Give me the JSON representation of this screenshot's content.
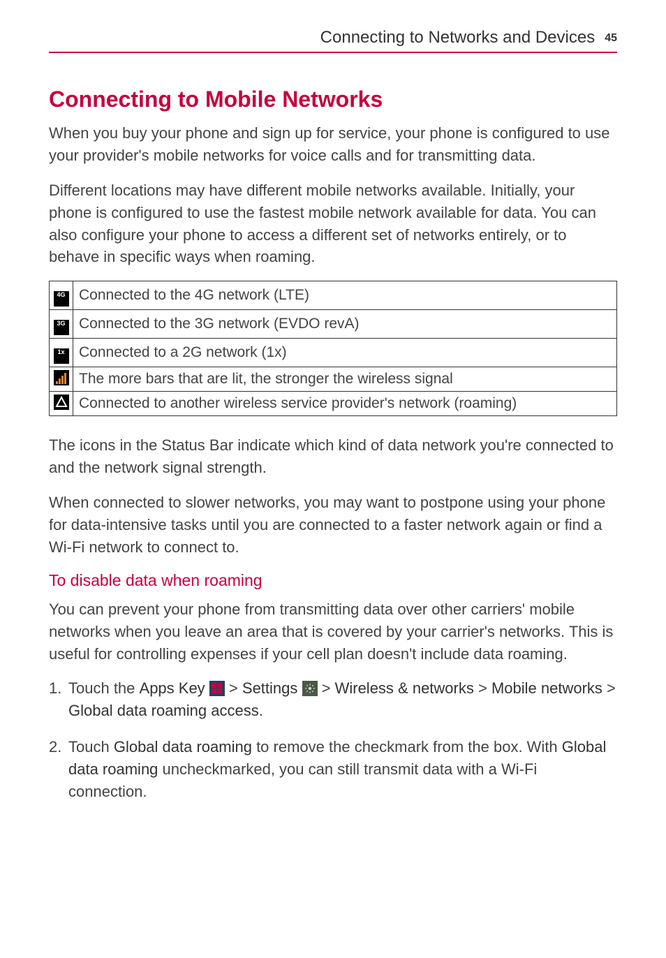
{
  "header": {
    "title": "Connecting to Networks and Devices",
    "page": "45"
  },
  "h1": "Connecting to Mobile Networks",
  "intro1": "When you buy your phone and sign up for service, your phone is configured to use your provider's mobile networks for voice calls and for transmitting data.",
  "intro2": "Different locations may have different mobile networks available. Initially, your phone is configured to use the fastest mobile network available for data. You can also configure your phone to access a different set of networks entirely, or to behave in specific ways when roaming.",
  "table": {
    "rows": [
      {
        "icon_label": "4G",
        "desc": "Connected to the 4G network (LTE)"
      },
      {
        "icon_label": "3G",
        "desc": "Connected to the 3G network (EVDO revA)"
      },
      {
        "icon_label": "1x",
        "desc": "Connected to a 2G network (1x)"
      },
      {
        "icon_label": "",
        "desc": "The more bars that are lit, the stronger the wireless signal"
      },
      {
        "icon_label": "",
        "desc": "Connected to another wireless service provider's network (roaming)"
      }
    ]
  },
  "para_after1": "The icons in the Status Bar indicate which kind of data network you're connected to and the network signal strength.",
  "para_after2": "When connected to slower networks, you may want to postpone using your phone for data-intensive tasks until you are connected to a faster network again or find a Wi-Fi network to connect to.",
  "h2": "To disable data when roaming",
  "roam_intro": "You can prevent your phone from transmitting data over other carriers' mobile networks when you leave an area that is covered by your carrier's networks. This is useful for controlling expenses if your cell plan doesn't include data roaming.",
  "step1": {
    "pre": "Touch the ",
    "apps_key": "Apps Key",
    "mid1": " > ",
    "settings": "Settings",
    "mid2": " > ",
    "wireless": "Wireless & networks",
    "mid3": " > ",
    "mobile_networks": "Mobile networks",
    "mid4": " > ",
    "global_access": "Global data roaming access",
    "end": "."
  },
  "step2": {
    "pre": "Touch ",
    "bold1": "Global data roaming",
    "mid1": " to remove the checkmark from the box. With ",
    "bold2": "Global data roaming",
    "mid2": " uncheckmarked, you can still transmit data with a Wi-Fi connection."
  }
}
